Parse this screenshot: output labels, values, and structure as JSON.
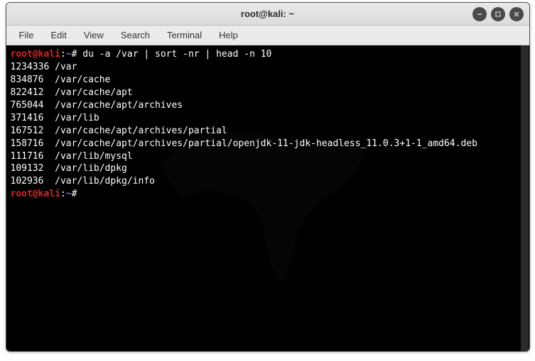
{
  "window": {
    "title": "root@kali: ~"
  },
  "menubar": {
    "items": [
      "File",
      "Edit",
      "View",
      "Search",
      "Terminal",
      "Help"
    ]
  },
  "prompt": {
    "user_host": "root@kali",
    "separator": ":",
    "path": "~",
    "symbol": "#"
  },
  "command": "du -a /var | sort -nr | head -n 10",
  "output": [
    {
      "size": "1234336",
      "path": "/var"
    },
    {
      "size": "834876 ",
      "path": "/var/cache"
    },
    {
      "size": "822412 ",
      "path": "/var/cache/apt"
    },
    {
      "size": "765044 ",
      "path": "/var/cache/apt/archives"
    },
    {
      "size": "371416 ",
      "path": "/var/lib"
    },
    {
      "size": "167512 ",
      "path": "/var/cache/apt/archives/partial"
    },
    {
      "size": "158716 ",
      "path": "/var/cache/apt/archives/partial/openjdk-11-jdk-headless_11.0.3+1-1_amd64.deb"
    },
    {
      "size": "111716 ",
      "path": "/var/lib/mysql"
    },
    {
      "size": "109132 ",
      "path": "/var/lib/dpkg"
    },
    {
      "size": "102936 ",
      "path": "/var/lib/dpkg/info"
    }
  ]
}
